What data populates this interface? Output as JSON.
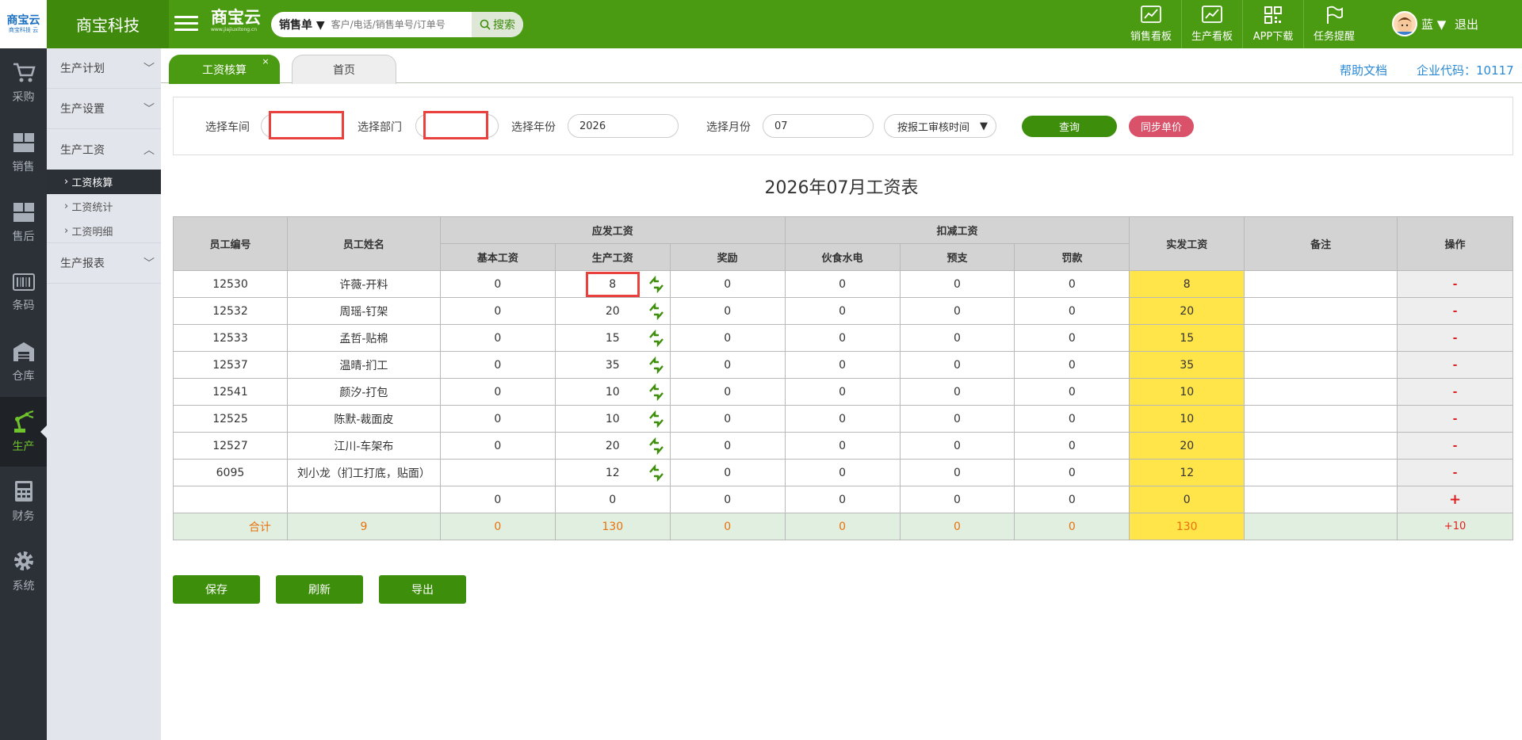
{
  "brand": {
    "logo_line1": "商宝云",
    "logo_line2": "商宝科技 云",
    "company": "商宝科技",
    "cloud_name": "商宝云",
    "cloud_url": "www.jiajiuxitong.cn"
  },
  "search": {
    "type_label": "销售单 ▼",
    "placeholder": "客户/电话/销售单号/订单号",
    "button": "搜索"
  },
  "topnav": [
    {
      "label": "销售看板",
      "icon": "chart-line-icon"
    },
    {
      "label": "生产看板",
      "icon": "chart-line-icon"
    },
    {
      "label": "APP下载",
      "icon": "qr-code-icon"
    },
    {
      "label": "任务提醒",
      "icon": "flag-icon"
    }
  ],
  "user": {
    "name": "蓝 ▼",
    "logout": "退出"
  },
  "leftnav": [
    {
      "label": "采购",
      "icon": "cart-icon"
    },
    {
      "label": "销售",
      "icon": "boxes-icon"
    },
    {
      "label": "售后",
      "icon": "boxes-icon"
    },
    {
      "label": "条码",
      "icon": "barcode-icon"
    },
    {
      "label": "仓库",
      "icon": "warehouse-icon"
    },
    {
      "label": "生产",
      "icon": "robot-arm-icon",
      "active": true
    },
    {
      "label": "财务",
      "icon": "calculator-icon"
    },
    {
      "label": "系统",
      "icon": "gear-icon"
    }
  ],
  "subnav": {
    "groups": [
      "生产计划",
      "生产设置",
      "生产工资",
      "生产报表"
    ],
    "items": [
      "工资核算",
      "工资统计",
      "工资明细"
    ]
  },
  "tabs": {
    "active": "工资核算",
    "home": "首页",
    "help": "帮助文档",
    "corp": "企业代码：10117"
  },
  "filter": {
    "workshop_label": "选择车间",
    "dept_label": "选择部门",
    "year_label": "选择年份",
    "year_value": "2026",
    "month_label": "选择月份",
    "month_value": "07",
    "mode_value": "按报工审核时间",
    "query": "查询",
    "sync": "同步单价"
  },
  "table_title": "2026年07月工资表",
  "columns": {
    "emp_id": "员工编号",
    "emp_name": "员工姓名",
    "payable": "应发工资",
    "base": "基本工资",
    "production": "生产工资",
    "bonus": "奖励",
    "deduct": "扣减工资",
    "meal": "伙食水电",
    "advance": "预支",
    "fine": "罚款",
    "actual": "实发工资",
    "remark": "备注",
    "op": "操作"
  },
  "rows": [
    {
      "id": "12530",
      "name": "许薇-开料",
      "base": "0",
      "prod": "8",
      "bonus": "0",
      "meal": "0",
      "adv": "0",
      "fine": "0",
      "actual": "8",
      "op": "-"
    },
    {
      "id": "12532",
      "name": "周瑶-钉架",
      "base": "0",
      "prod": "20",
      "bonus": "0",
      "meal": "0",
      "adv": "0",
      "fine": "0",
      "actual": "20",
      "op": "-"
    },
    {
      "id": "12533",
      "name": "孟哲-贴棉",
      "base": "0",
      "prod": "15",
      "bonus": "0",
      "meal": "0",
      "adv": "0",
      "fine": "0",
      "actual": "15",
      "op": "-"
    },
    {
      "id": "12537",
      "name": "温晴-扪工",
      "base": "0",
      "prod": "35",
      "bonus": "0",
      "meal": "0",
      "adv": "0",
      "fine": "0",
      "actual": "35",
      "op": "-"
    },
    {
      "id": "12541",
      "name": "颜汐-打包",
      "base": "0",
      "prod": "10",
      "bonus": "0",
      "meal": "0",
      "adv": "0",
      "fine": "0",
      "actual": "10",
      "op": "-"
    },
    {
      "id": "12525",
      "name": "陈默-裁面皮",
      "base": "0",
      "prod": "10",
      "bonus": "0",
      "meal": "0",
      "adv": "0",
      "fine": "0",
      "actual": "10",
      "op": "-"
    },
    {
      "id": "12527",
      "name": "江川-车架布",
      "base": "0",
      "prod": "20",
      "bonus": "0",
      "meal": "0",
      "adv": "0",
      "fine": "0",
      "actual": "20",
      "op": "-"
    },
    {
      "id": "6095",
      "name": "刘小龙（扪工打底，贴面）",
      "base": "",
      "prod": "12",
      "bonus": "0",
      "meal": "0",
      "adv": "0",
      "fine": "0",
      "actual": "12",
      "op": "-"
    }
  ],
  "blank_row": {
    "base": "0",
    "prod": "0",
    "bonus": "0",
    "meal": "0",
    "adv": "0",
    "fine": "0",
    "actual": "0",
    "op": "+"
  },
  "sum_row": {
    "label": "合计",
    "count": "9",
    "base": "0",
    "prod": "130",
    "bonus": "0",
    "meal": "0",
    "adv": "0",
    "fine": "0",
    "actual": "130",
    "op": "+10"
  },
  "actions": {
    "save": "保存",
    "refresh": "刷新",
    "export": "导出"
  },
  "colors": {
    "primary_green": "#4a9b12",
    "highlight_yellow": "#ffe44a",
    "alert_red": "#e8413e",
    "sync_pink": "#d9526a"
  }
}
